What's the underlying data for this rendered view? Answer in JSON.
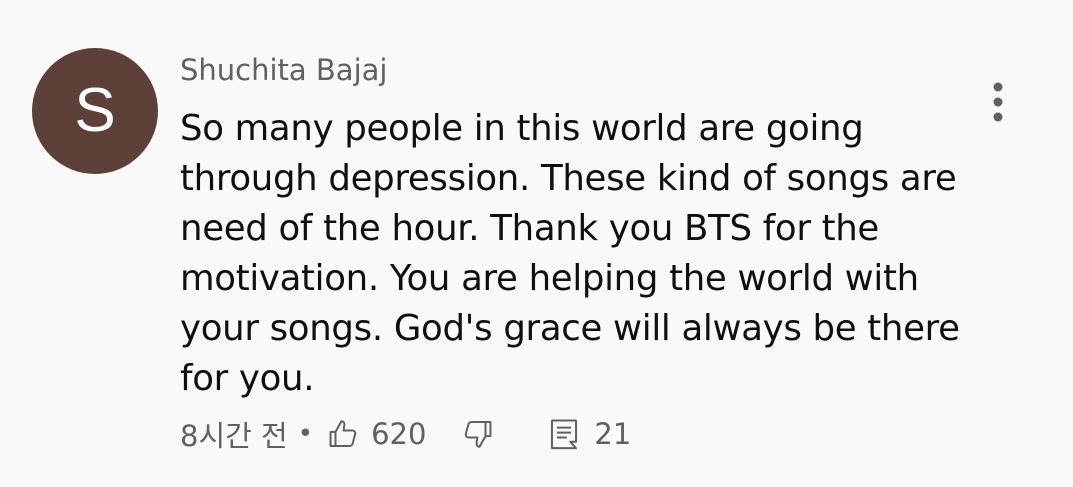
{
  "comment": {
    "avatar_initial": "S",
    "avatar_color": "#5d4037",
    "author": "Shuchita Bajaj",
    "text": "So many people in this world are going through depression. These kind of songs are need of the hour. Thank you BTS for the motivation. You are helping the world with your songs. God's grace will always be there for you.",
    "timestamp": "8시간 전",
    "separator": "•",
    "like_count": "620",
    "reply_count": "21",
    "icons": {
      "like": "thumb-up-icon",
      "dislike": "thumb-down-icon",
      "reply": "comment-icon",
      "menu": "more-vertical-icon"
    }
  }
}
